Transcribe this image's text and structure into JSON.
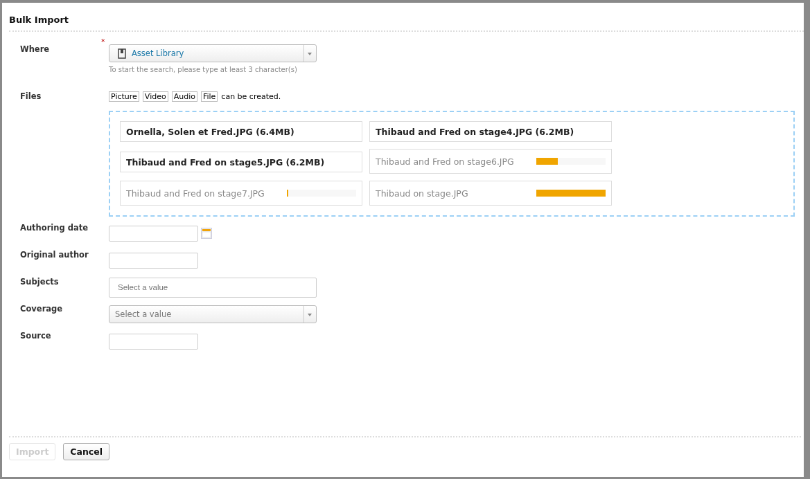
{
  "dialog": {
    "title": "Bulk Import"
  },
  "where": {
    "label": "Where",
    "required": true,
    "required_mark": "*",
    "value": "Asset Library",
    "help": "To start the search, please type at least 3 character(s)"
  },
  "files": {
    "label": "Files",
    "types": [
      "Picture",
      "Video",
      "Audio",
      "File"
    ],
    "types_suffix": "can be created.",
    "items": [
      {
        "kind": "done",
        "name": "Ornella, Solen et Fred.JPG (6.4MB)"
      },
      {
        "kind": "done",
        "name": "Thibaud and Fred on stage4.JPG (6.2MB)"
      },
      {
        "kind": "done",
        "name": "Thibaud and Fred on stage5.JPG (6.2MB)"
      },
      {
        "kind": "uploading",
        "name": "Thibaud and Fred on stage6.JPG",
        "level": 0.31
      },
      {
        "kind": "uploading",
        "name": "Thibaud and Fred on stage7.JPG",
        "level": 0.02
      },
      {
        "kind": "uploading",
        "name": "Thibaud on stage.JPG",
        "level": 1.0
      }
    ]
  },
  "fields": [
    {
      "kind": "date",
      "label": "Authoring date"
    },
    {
      "kind": "text",
      "label": "Original author"
    },
    {
      "kind": "multi",
      "label": "Subjects",
      "placeholder": "Select a value"
    },
    {
      "kind": "select",
      "label": "Coverage",
      "placeholder": "Select a value"
    },
    {
      "kind": "text",
      "label": "Source"
    }
  ],
  "buttons": [
    {
      "label": "Import",
      "disabled": true
    },
    {
      "label": "Cancel",
      "disabled": false
    }
  ]
}
